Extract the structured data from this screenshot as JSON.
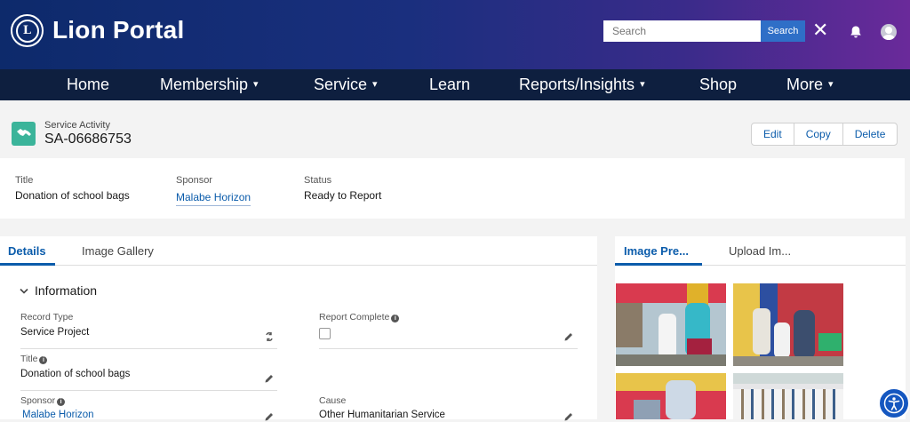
{
  "header": {
    "brand": "Lion Portal",
    "logo_letters": "L",
    "search_placeholder": "Search",
    "search_button": "Search",
    "close_glyph": "✕"
  },
  "nav": {
    "items": [
      {
        "label": "Home",
        "has_menu": false
      },
      {
        "label": "Membership",
        "has_menu": true
      },
      {
        "label": "Service",
        "has_menu": true
      },
      {
        "label": "Learn",
        "has_menu": false
      },
      {
        "label": "Reports/Insights",
        "has_menu": true
      },
      {
        "label": "Shop",
        "has_menu": false
      },
      {
        "label": "More",
        "has_menu": true
      }
    ],
    "chevron": "▾"
  },
  "record": {
    "object_type": "Service Activity",
    "id": "SA-06686753",
    "actions": [
      "Edit",
      "Copy",
      "Delete"
    ]
  },
  "highlights": {
    "title_label": "Title",
    "title_value": "Donation of school bags",
    "sponsor_label": "Sponsor",
    "sponsor_value": "Malabe Horizon",
    "status_label": "Status",
    "status_value": "Ready to Report"
  },
  "tabs": {
    "details": "Details",
    "gallery": "Image Gallery"
  },
  "details": {
    "section": "Information",
    "record_type_label": "Record Type",
    "record_type_value": "Service Project",
    "report_complete_label": "Report Complete",
    "title_label": "Title",
    "title_value": "Donation of school bags",
    "sponsor_label": "Sponsor",
    "sponsor_value": "Malabe Horizon",
    "cause_label": "Cause",
    "cause_value": "Other Humanitarian Service",
    "info_glyph": "i"
  },
  "side_tabs": {
    "preview": "Image Pre...",
    "upload": "Upload Im..."
  },
  "colors": {
    "accent": "#0b5cab",
    "record_icon": "#3bb49a",
    "nav_bg": "#0e1f3f"
  }
}
